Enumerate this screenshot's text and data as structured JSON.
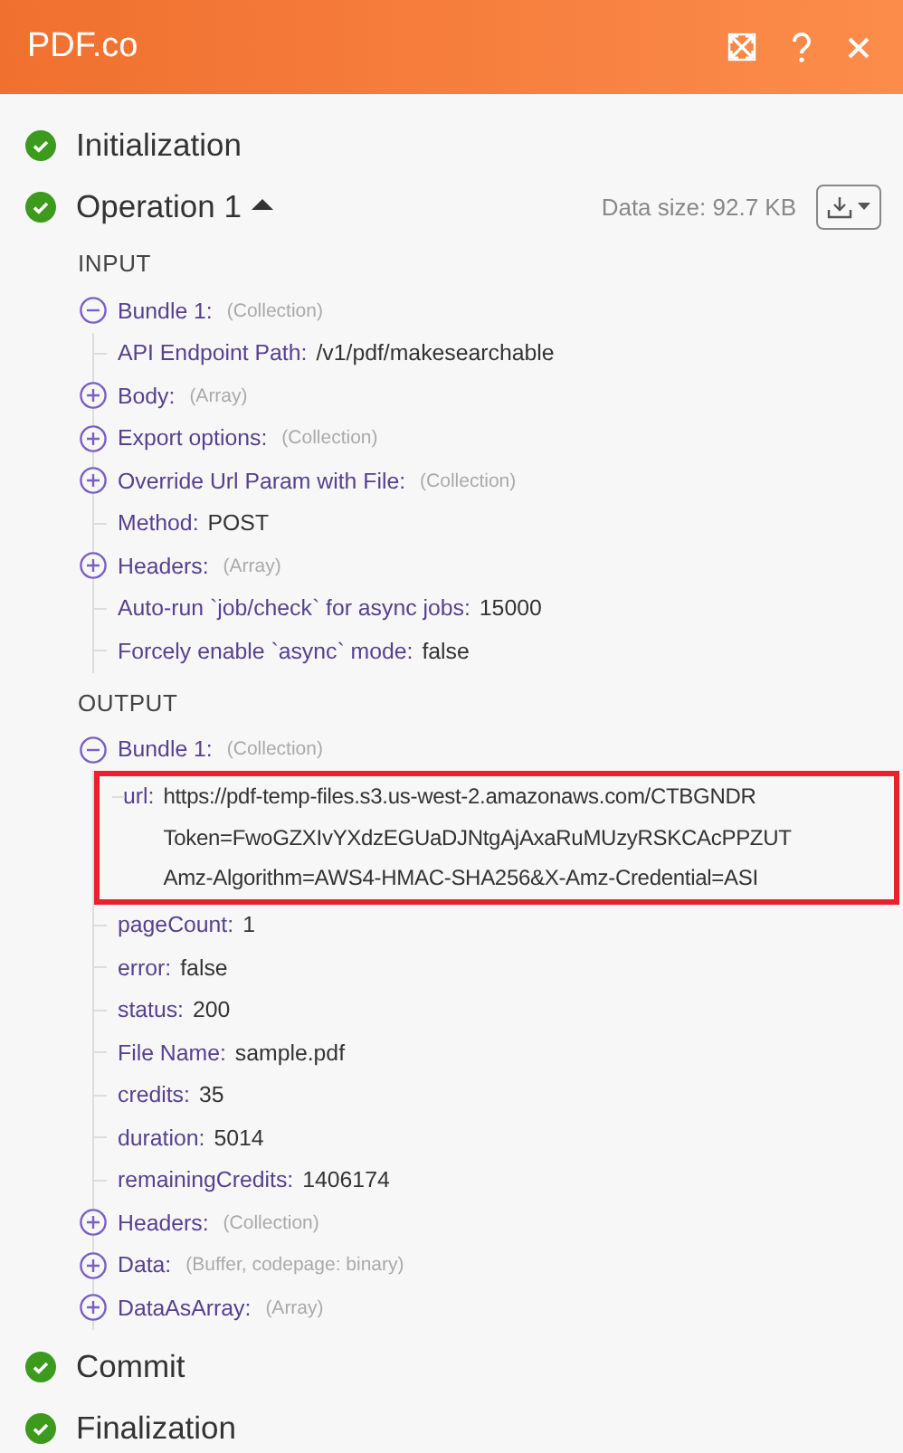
{
  "header": {
    "title": "PDF.co"
  },
  "stages": [
    {
      "name": "Initialization",
      "done": true
    },
    {
      "name": "Operation 1",
      "done": true,
      "expanded": true,
      "data_size": "Data size: 92.7 KB",
      "sections": [
        {
          "title": "INPUT",
          "items": [
            {
              "label": "Bundle 1:",
              "type": "(Collection)",
              "expanded": true,
              "children": [
                {
                  "label": "API Endpoint Path:",
                  "value": "/v1/pdf/makesearchable"
                },
                {
                  "label": "Body:",
                  "type": "(Array)",
                  "expanded": false
                },
                {
                  "label": "Export options:",
                  "type": "(Collection)",
                  "expanded": false
                },
                {
                  "label": "Override Url Param with File:",
                  "type": "(Collection)",
                  "expanded": false
                },
                {
                  "label": "Method:",
                  "value": "POST"
                },
                {
                  "label": "Headers:",
                  "type": "(Array)",
                  "expanded": false
                },
                {
                  "label": "Auto-run `job/check` for async jobs:",
                  "value": "15000"
                },
                {
                  "label": "Forcely enable `async` mode:",
                  "value": "false"
                }
              ]
            }
          ]
        },
        {
          "title": "OUTPUT",
          "items": [
            {
              "label": "Bundle 1:",
              "type": "(Collection)",
              "expanded": true,
              "children": [
                {
                  "label": "url:",
                  "value_lines": [
                    "https://pdf-temp-files.s3.us-west-2.amazonaws.com/CTBGNDR",
                    "Token=FwoGZXIvYXdzEGUaDJNtgAjAxaRuMUzyRSKCAcPPZUT",
                    "Amz-Algorithm=AWS4-HMAC-SHA256&X-Amz-Credential=ASI"
                  ],
                  "highlighted": true
                },
                {
                  "label": "pageCount:",
                  "value": "1"
                },
                {
                  "label": "error:",
                  "value": "false"
                },
                {
                  "label": "status:",
                  "value": "200"
                },
                {
                  "label": "File Name:",
                  "value": "sample.pdf"
                },
                {
                  "label": "credits:",
                  "value": "35"
                },
                {
                  "label": "duration:",
                  "value": "5014"
                },
                {
                  "label": "remainingCredits:",
                  "value": "1406174"
                },
                {
                  "label": "Headers:",
                  "type": "(Collection)",
                  "expanded": false
                },
                {
                  "label": "Data:",
                  "type": "(Buffer, codepage: binary)",
                  "expanded": false
                },
                {
                  "label": "DataAsArray:",
                  "type": "(Array)",
                  "expanded": false
                }
              ]
            }
          ]
        }
      ]
    },
    {
      "name": "Commit",
      "done": true
    },
    {
      "name": "Finalization",
      "done": true
    }
  ]
}
